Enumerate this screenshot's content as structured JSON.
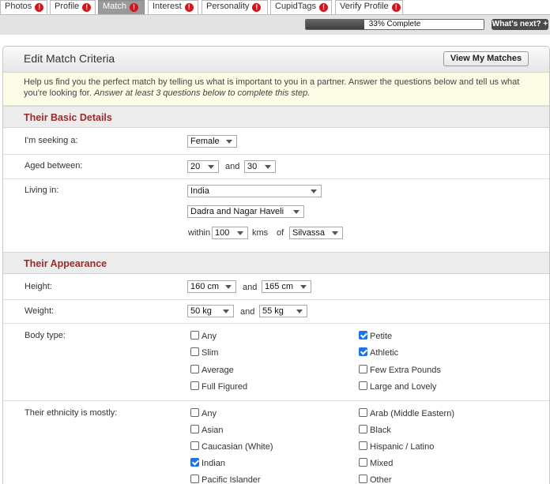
{
  "tabs": [
    {
      "label": "Photos",
      "badge": "!"
    },
    {
      "label": "Profile",
      "badge": "!"
    },
    {
      "label": "Match",
      "badge": "!"
    },
    {
      "label": "Interest",
      "badge": "!"
    },
    {
      "label": "Personality",
      "badge": "!"
    },
    {
      "label": "CupidTags",
      "badge": "!"
    },
    {
      "label": "Verify Profile",
      "badge": "!"
    }
  ],
  "progress": {
    "fraction": 0.33,
    "label": "33% Complete"
  },
  "whats_next": "What's next? +",
  "panel": {
    "title": "Edit Match Criteria",
    "view_matches": "View My Matches",
    "intro": "Help us find you the perfect match by telling us what is important to you in a partner. Answer the questions below and tell us what you're looking for.",
    "intro_em": "Answer at least 3 questions below to complete this step."
  },
  "basic": {
    "heading": "Their Basic Details",
    "seeking_label": "I'm seeking a:",
    "seeking_value": "Female",
    "aged_label": "Aged between:",
    "age_from": "20",
    "and1": "and",
    "age_to": "30",
    "living_label": "Living in:",
    "country": "India",
    "state": "Dadra and Nagar Haveli",
    "within": "within",
    "distance": "100",
    "kms": "kms",
    "of": "of",
    "city": "Silvassa"
  },
  "appearance": {
    "heading": "Their Appearance",
    "height_label": "Height:",
    "height_from": "160 cm",
    "and_h": "and",
    "height_to": "165 cm",
    "weight_label": "Weight:",
    "weight_from": "50 kg",
    "and_w": "and",
    "weight_to": "55 kg",
    "body_label": "Body type:",
    "body_left": [
      {
        "label": "Any",
        "checked": false
      },
      {
        "label": "Slim",
        "checked": false
      },
      {
        "label": "Average",
        "checked": false
      },
      {
        "label": "Full Figured",
        "checked": false
      }
    ],
    "body_right": [
      {
        "label": "Petite",
        "checked": true
      },
      {
        "label": "Athletic",
        "checked": true
      },
      {
        "label": "Few Extra Pounds",
        "checked": false
      },
      {
        "label": "Large and Lovely",
        "checked": false
      }
    ],
    "ethnicity_label": "Their ethnicity is mostly:",
    "eth_left": [
      {
        "label": "Any",
        "checked": false
      },
      {
        "label": "Asian",
        "checked": false
      },
      {
        "label": "Caucasian (White)",
        "checked": false
      },
      {
        "label": "Indian",
        "checked": true
      },
      {
        "label": "Pacific Islander",
        "checked": false
      }
    ],
    "eth_right": [
      {
        "label": "Arab (Middle Eastern)",
        "checked": false
      },
      {
        "label": "Black",
        "checked": false
      },
      {
        "label": "Hispanic / Latino",
        "checked": false
      },
      {
        "label": "Mixed",
        "checked": false
      },
      {
        "label": "Other",
        "checked": false
      }
    ]
  }
}
